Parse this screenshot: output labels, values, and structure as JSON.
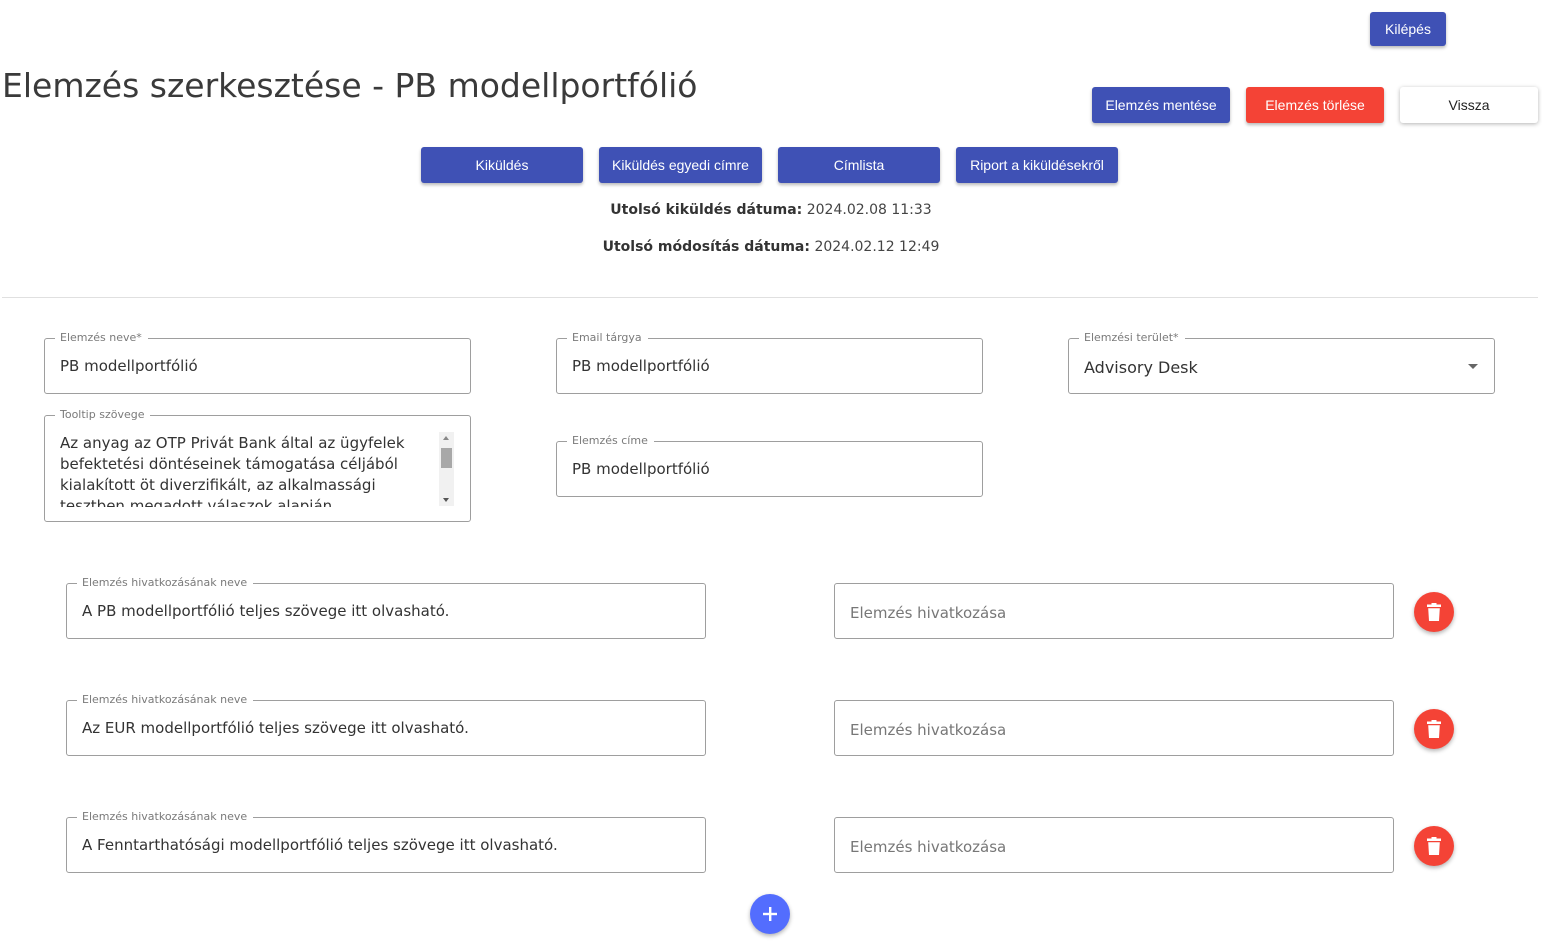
{
  "header": {
    "logout_label": "Kilépés",
    "title": "Elemzés szerkesztése - PB modellportfólió"
  },
  "actions": {
    "save_label": "Elemzés mentése",
    "delete_label": "Elemzés törlése",
    "back_label": "Vissza"
  },
  "send_actions": {
    "send_label": "Kiküldés",
    "send_custom_label": "Kiküldés egyedi címre",
    "address_list_label": "Címlista",
    "report_label": "Riport a kiküldésekről"
  },
  "info": {
    "last_send_label": "Utolsó kiküldés dátuma:",
    "last_send_value": "2024.02.08 11:33",
    "last_modified_label": "Utolsó módosítás dátuma:",
    "last_modified_value": "2024.02.12 12:49"
  },
  "form": {
    "name": {
      "label": "Elemzés neve*",
      "value": "PB modellportfólió"
    },
    "email_subject": {
      "label": "Email tárgya",
      "value": "PB modellportfólió"
    },
    "area": {
      "label": "Elemzési terület*",
      "value": "Advisory Desk"
    },
    "tooltip": {
      "label": "Tooltip szövege",
      "value": "Az anyag az OTP Privát Bank által az ügyfelek befektetési döntéseinek támogatása céljából kialakított öt diverzifikált, az alkalmassági tesztben megadott válaszok alapján meghatározott ügyfél"
    },
    "title": {
      "label": "Elemzés címe",
      "value": "PB modellportfólió"
    }
  },
  "links": [
    {
      "name_label": "Elemzés hivatkozásának neve",
      "name_value": "A PB modellportfólió teljes szövege itt olvasható.",
      "url_placeholder": "Elemzés hivatkozása"
    },
    {
      "name_label": "Elemzés hivatkozásának neve",
      "name_value": "Az EUR modellportfólió teljes szövege itt olvasható.",
      "url_placeholder": "Elemzés hivatkozása"
    },
    {
      "name_label": "Elemzés hivatkozásának neve",
      "name_value": "A Fenntarthatósági modellportfólió teljes szövege itt olvasható.",
      "url_placeholder": "Elemzés hivatkozása"
    }
  ],
  "icons": {
    "delete": "trash-icon",
    "add": "plus-icon"
  },
  "colors": {
    "primary": "#3f51b5",
    "danger": "#f44336",
    "accent": "#536dfe"
  }
}
